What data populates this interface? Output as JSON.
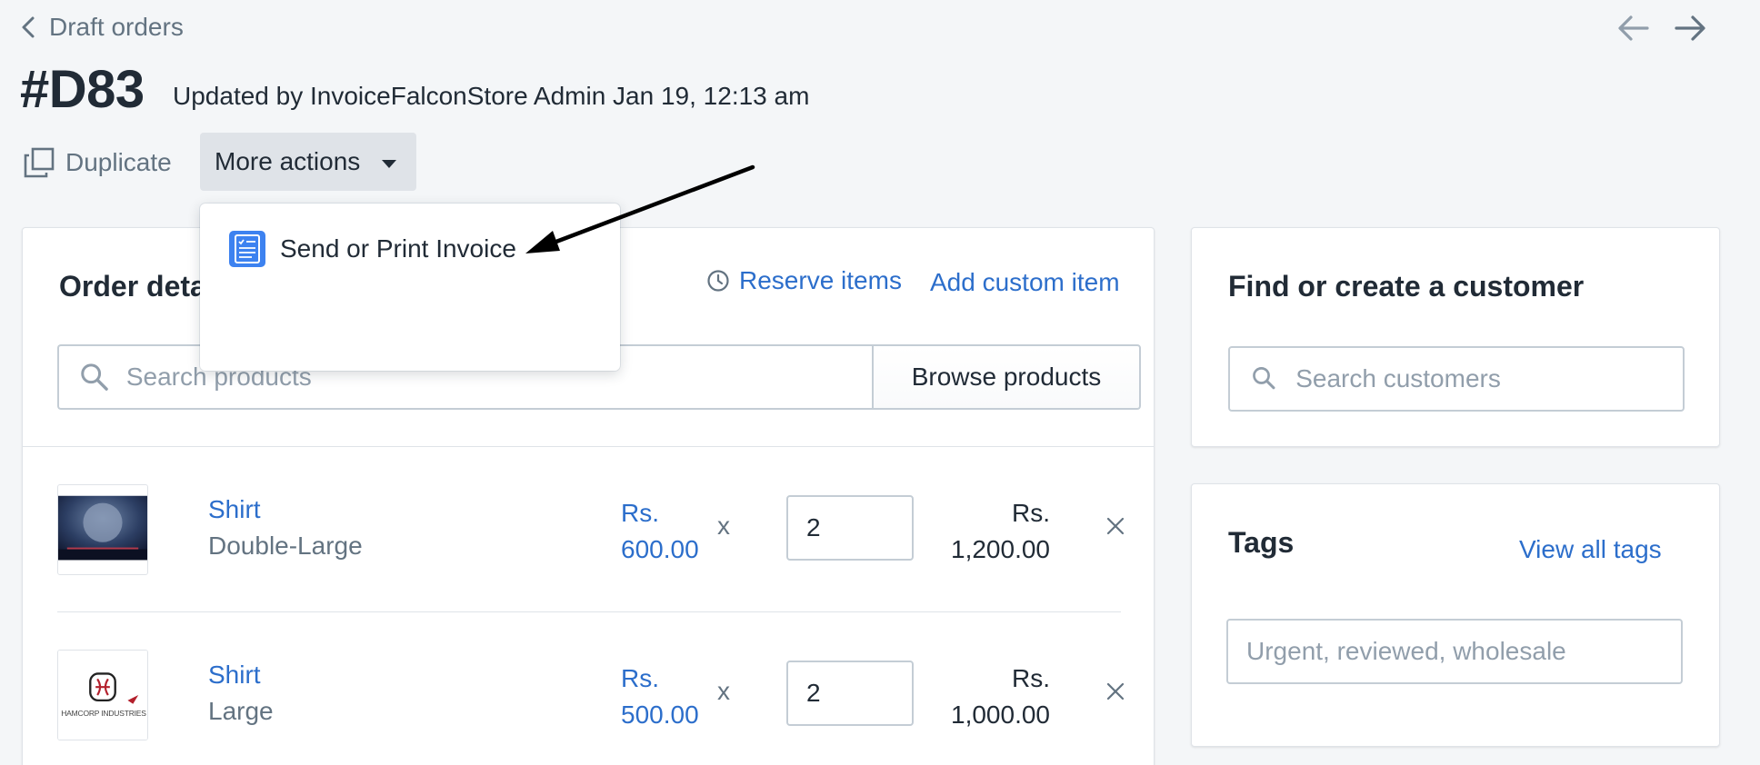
{
  "nav": {
    "back_label": "Draft orders"
  },
  "header": {
    "title": "#D83",
    "updated_by": "Updated by InvoiceFalconStore Admin Jan 19, 12:13 am"
  },
  "actions": {
    "duplicate_label": "Duplicate",
    "more_actions_label": "More actions"
  },
  "dropdown": {
    "items": [
      {
        "label": "Send or Print Invoice",
        "icon": "invoice-icon"
      }
    ]
  },
  "order_details": {
    "title": "Order deta",
    "reserve_items_label": "Reserve items",
    "add_custom_item_label": "Add custom item",
    "search_placeholder": "Search products",
    "browse_products_label": "Browse products",
    "line_items": [
      {
        "name": "Shirt",
        "variant": "Double-Large",
        "price_currency": "Rs.",
        "price_amount": "600.00",
        "times": "x",
        "quantity": "2",
        "total_currency": "Rs.",
        "total_amount": "1,200.00"
      },
      {
        "name": "Shirt",
        "variant": "Large",
        "price_currency": "Rs.",
        "price_amount": "500.00",
        "times": "x",
        "quantity": "2",
        "total_currency": "Rs.",
        "total_amount": "1,000.00",
        "thumb_text": "HAMCORP INDUSTRIES"
      }
    ]
  },
  "customer": {
    "title": "Find or create a customer",
    "search_placeholder": "Search customers"
  },
  "tags": {
    "title": "Tags",
    "view_all_label": "View all tags",
    "input_placeholder": "Urgent, reviewed, wholesale"
  },
  "colors": {
    "background": "#f4f6f8",
    "link": "#2c6ecb",
    "text": "#212b36",
    "subdued": "#637381",
    "border": "#c4cdd5",
    "invoice_icon": "#3d82f0"
  }
}
